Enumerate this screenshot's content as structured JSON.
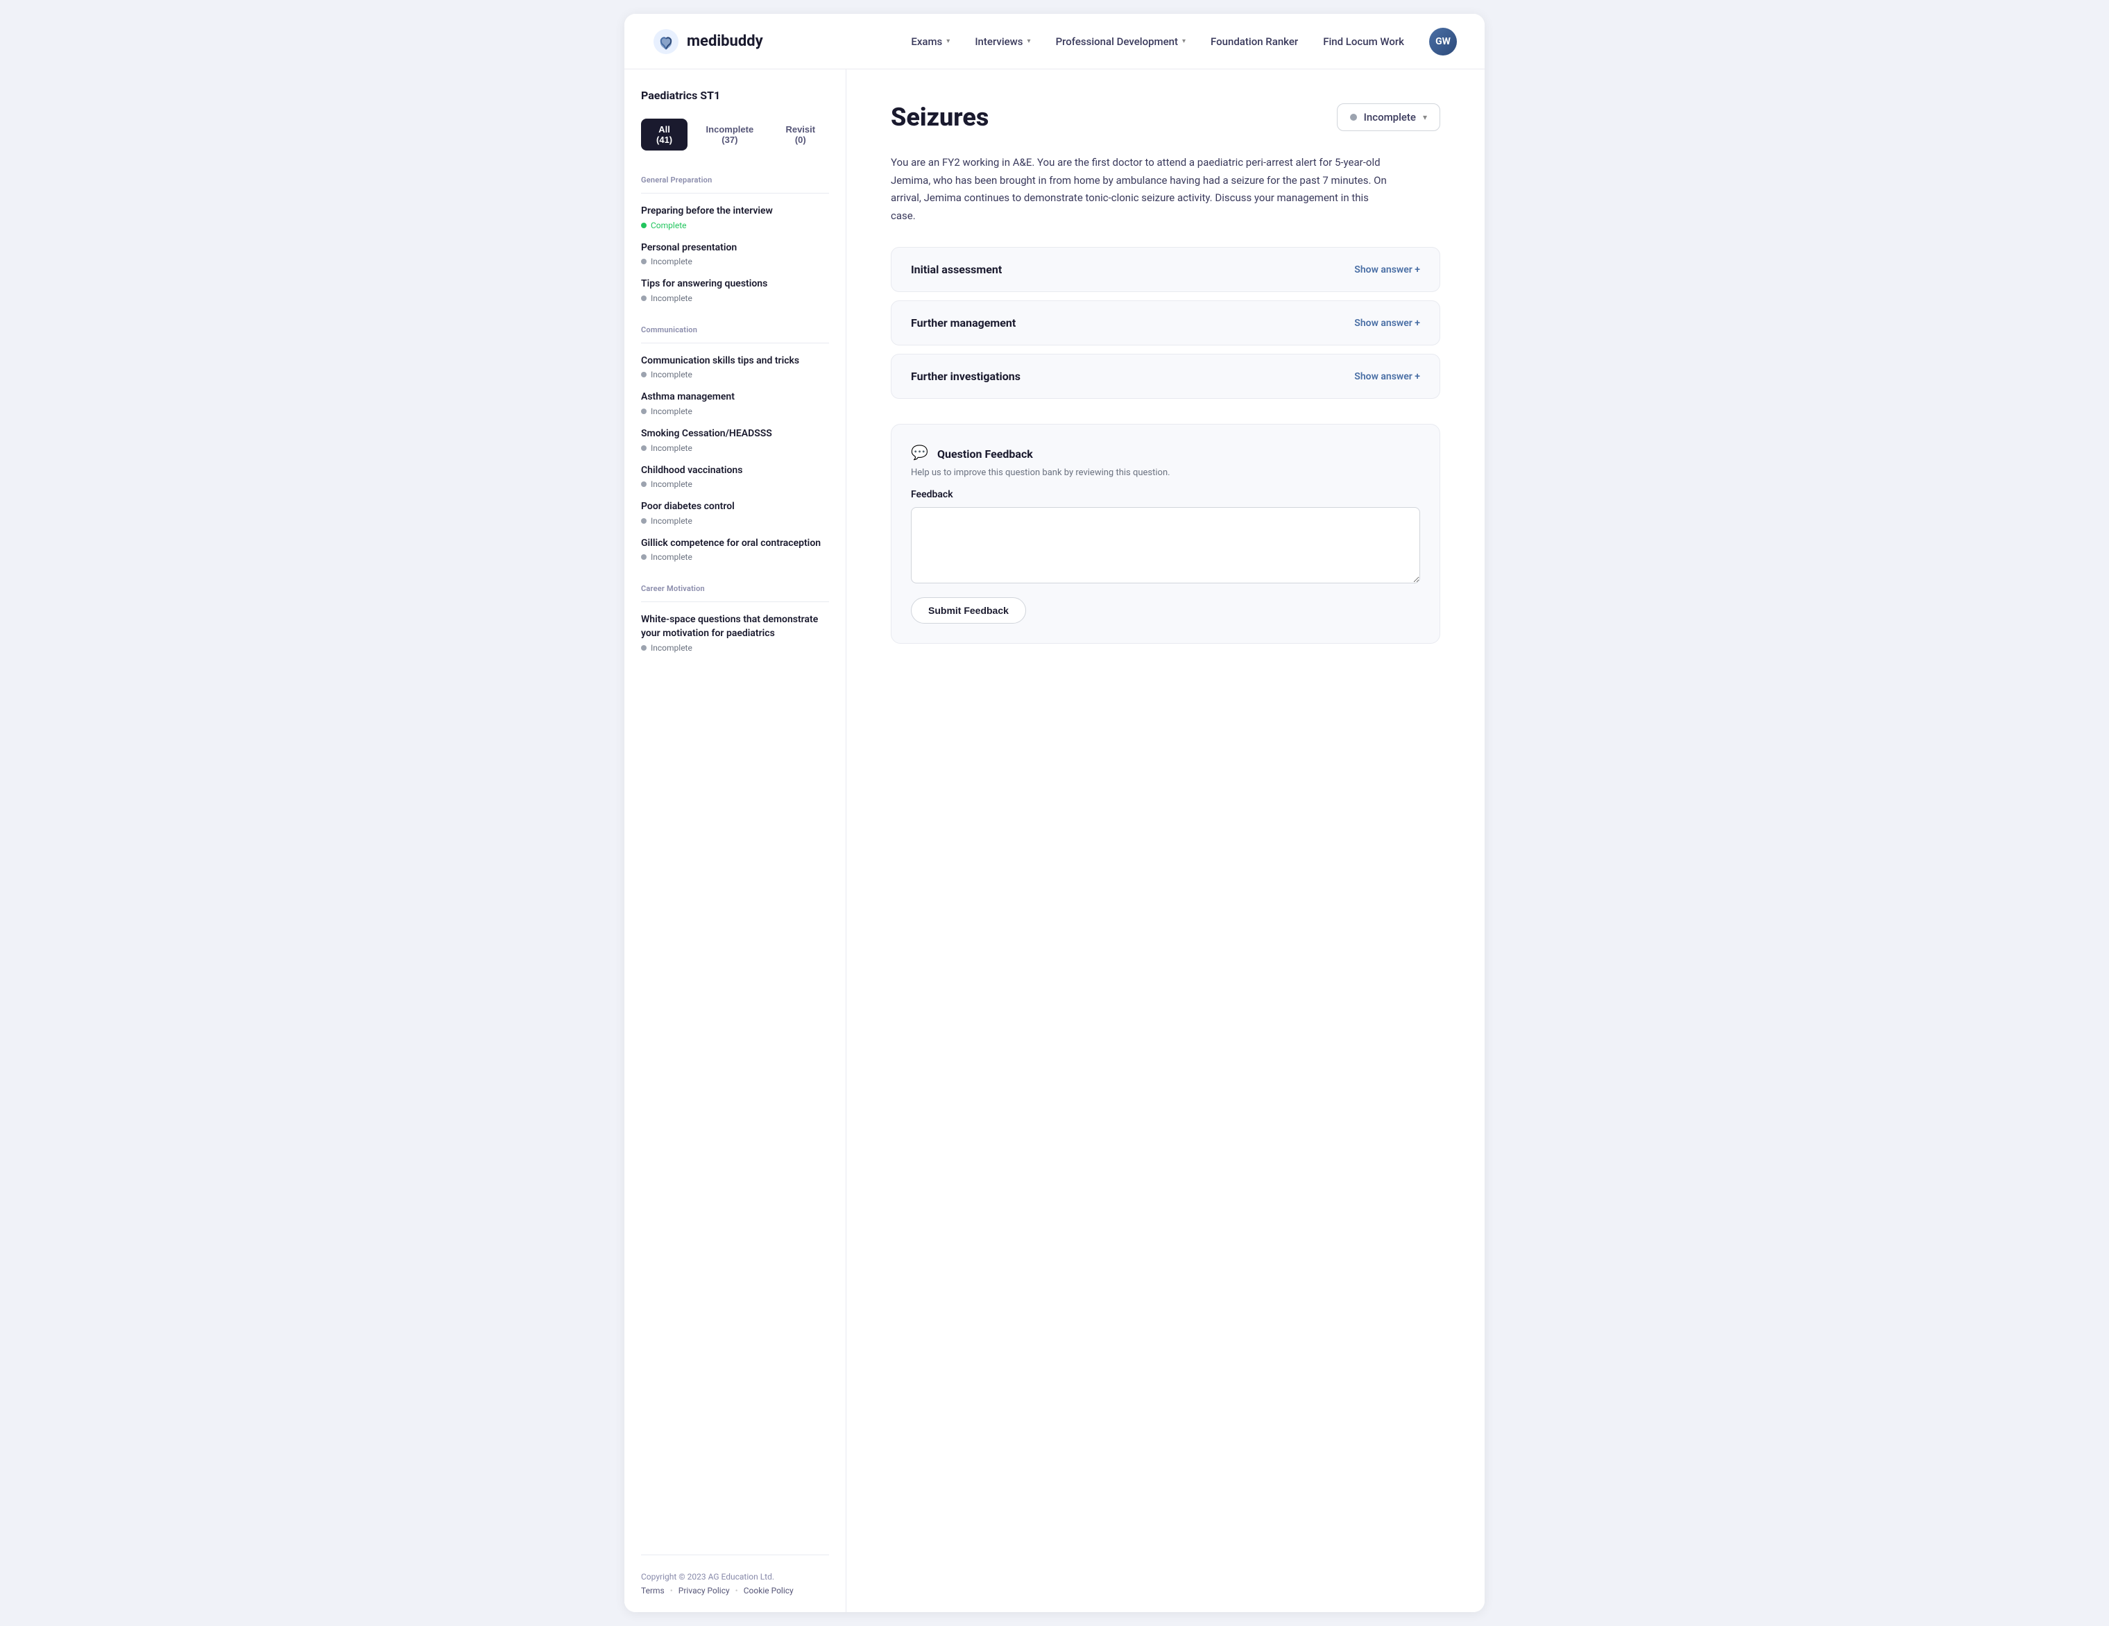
{
  "header": {
    "logo_text": "medibuddy",
    "nav": [
      {
        "label": "Exams",
        "has_dropdown": true
      },
      {
        "label": "Interviews",
        "has_dropdown": true
      },
      {
        "label": "Professional Development",
        "has_dropdown": true
      },
      {
        "label": "Foundation Ranker",
        "has_dropdown": false
      },
      {
        "label": "Find Locum Work",
        "has_dropdown": false
      }
    ],
    "avatar_initials": "GW"
  },
  "sidebar": {
    "title": "Paediatrics ST1",
    "tabs": [
      {
        "label": "All (41)",
        "active": true
      },
      {
        "label": "Incomplete (37)",
        "active": false
      },
      {
        "label": "Revisit (0)",
        "active": false
      }
    ],
    "sections": [
      {
        "label": "General Preparation",
        "items": [
          {
            "title": "Preparing before the interview",
            "status": "complete",
            "status_label": "Complete"
          },
          {
            "title": "Personal presentation",
            "status": "incomplete",
            "status_label": "Incomplete"
          },
          {
            "title": "Tips for answering questions",
            "status": "incomplete",
            "status_label": "Incomplete"
          }
        ]
      },
      {
        "label": "Communication",
        "items": [
          {
            "title": "Communication skills tips and tricks",
            "status": "incomplete",
            "status_label": "Incomplete"
          },
          {
            "title": "Asthma management",
            "status": "incomplete",
            "status_label": "Incomplete"
          },
          {
            "title": "Smoking Cessation/HEADSSS",
            "status": "incomplete",
            "status_label": "Incomplete"
          },
          {
            "title": "Childhood vaccinations",
            "status": "incomplete",
            "status_label": "Incomplete"
          },
          {
            "title": "Poor diabetes control",
            "status": "incomplete",
            "status_label": "Incomplete"
          },
          {
            "title": "Gillick competence for oral contraception",
            "status": "incomplete",
            "status_label": "Incomplete"
          }
        ]
      },
      {
        "label": "Career Motivation",
        "items": [
          {
            "title": "White-space questions that demonstrate your motivation for paediatrics",
            "status": "incomplete",
            "status_label": "Incomplete"
          }
        ]
      }
    ],
    "footer": {
      "copyright": "Copyright © 2023 AG Education Ltd.",
      "links": [
        "Terms",
        "Privacy Policy",
        "Cookie Policy"
      ]
    }
  },
  "main": {
    "title": "Seizures",
    "status": "Incomplete",
    "description": "You are an FY2 working in A&E. You are the first doctor to attend a paediatric peri-arrest alert for 5-year-old Jemima, who has been brought in from home by ambulance having had a seizure for the past 7 minutes. On arrival, Jemima continues to demonstrate tonic-clonic seizure activity. Discuss your management in this case.",
    "accordion_items": [
      {
        "label": "Initial assessment",
        "action": "Show answer +"
      },
      {
        "label": "Further management",
        "action": "Show answer +"
      },
      {
        "label": "Further investigations",
        "action": "Show answer +"
      }
    ],
    "feedback": {
      "title": "Question Feedback",
      "subtitle": "Help us to improve this question bank by reviewing this question.",
      "label": "Feedback",
      "textarea_placeholder": "",
      "submit_label": "Submit Feedback"
    }
  }
}
